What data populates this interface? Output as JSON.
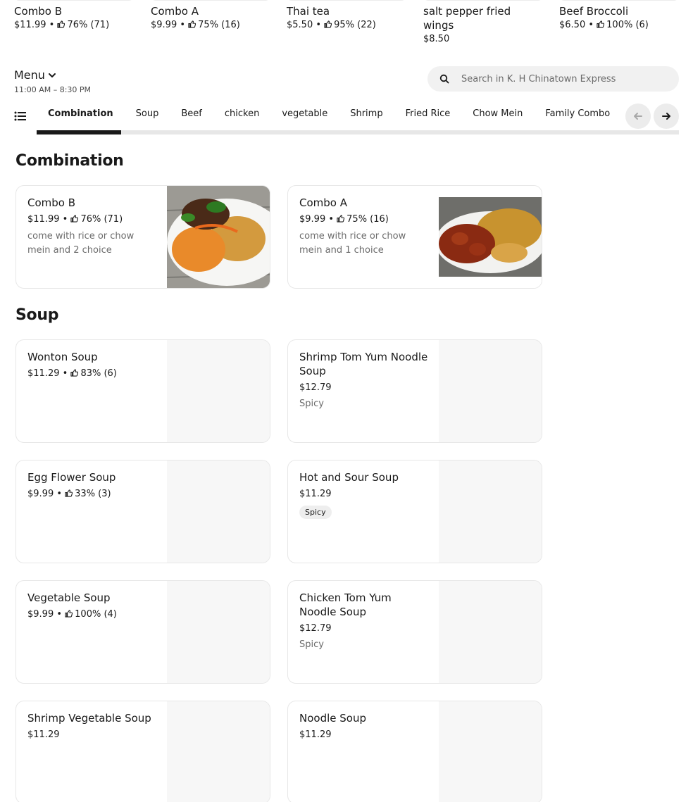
{
  "featured": [
    {
      "name": "Combo B",
      "price": "$11.99",
      "rating": "76% (71)"
    },
    {
      "name": "Combo A",
      "price": "$9.99",
      "rating": "75% (16)"
    },
    {
      "name": "Thai tea",
      "price": "$5.50",
      "rating": "95% (22)"
    },
    {
      "name": "salt pepper fried wings",
      "price": "$8.50",
      "rating": ""
    },
    {
      "name": "Beef Broccoli",
      "price": "$6.50",
      "rating": "100% (6)"
    }
  ],
  "menu": {
    "title": "Menu",
    "hours": "11:00 AM – 8:30 PM"
  },
  "search": {
    "placeholder": "Search in K. H Chinatown Express"
  },
  "tabs": [
    "Combination",
    "Soup",
    "Beef",
    "chicken",
    "vegetable",
    "Shrimp",
    "Fried Rice",
    "Chow Mein",
    "Family Combo"
  ],
  "sections": {
    "combination": {
      "title": "Combination",
      "items": [
        {
          "name": "Combo B",
          "price": "$11.99",
          "rating": "76% (71)",
          "desc": "come with rice or chow mein and 2 choice"
        },
        {
          "name": "Combo A",
          "price": "$9.99",
          "rating": "75% (16)",
          "desc": "come with rice or chow mein and 1 choice"
        }
      ]
    },
    "soup": {
      "title": "Soup",
      "items": [
        {
          "name": "Wonton Soup",
          "price": "$11.29",
          "rating": "83% (6)"
        },
        {
          "name": "Shrimp Tom Yum Noodle Soup",
          "price": "$12.79",
          "tag": "Spicy"
        },
        {
          "name": "Egg Flower Soup",
          "price": "$9.99",
          "rating": "33% (3)"
        },
        {
          "name": "Hot and Sour Soup",
          "price": "$11.29",
          "tag": "Spicy"
        },
        {
          "name": "Vegetable Soup",
          "price": "$9.99",
          "rating": "100% (4)"
        },
        {
          "name": "Chicken Tom Yum Noodle Soup",
          "price": "$12.79",
          "tag": "Spicy"
        },
        {
          "name": "Shrimp Vegetable Soup",
          "price": "$11.29"
        },
        {
          "name": "Noodle Soup",
          "price": "$11.29"
        }
      ]
    }
  },
  "colors": {
    "text": "#191919",
    "muted": "#6b6b6b",
    "border": "#e7e7e7",
    "search_bg": "#f1f1f1"
  }
}
